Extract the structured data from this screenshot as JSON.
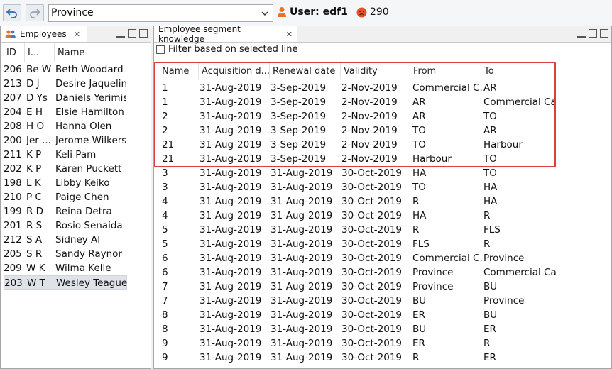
{
  "toolbar": {
    "province_value": "Province",
    "user_label": "User: edf1",
    "badge_count": "290"
  },
  "employees_panel": {
    "tab_label": "Employees",
    "col_id": "ID",
    "col_initials": "I...",
    "col_name": "Name",
    "rows": [
      {
        "id": "206",
        "ini": "Be W",
        "name": "Beth Woodard"
      },
      {
        "id": "213",
        "ini": "D J",
        "name": "Desire Jaqueline"
      },
      {
        "id": "207",
        "ini": "D Ys",
        "name": "Daniels Yerimis"
      },
      {
        "id": "204",
        "ini": "E H",
        "name": "Elsie Hamilton"
      },
      {
        "id": "208",
        "ini": "H O",
        "name": "Hanna Olen"
      },
      {
        "id": "200",
        "ini": "Jer ...",
        "name": "Jerome Wilkers..."
      },
      {
        "id": "211",
        "ini": "K P",
        "name": "Keli Pam"
      },
      {
        "id": "202",
        "ini": "K P",
        "name": "Karen Puckett"
      },
      {
        "id": "198",
        "ini": "L K",
        "name": "Libby Keiko"
      },
      {
        "id": "210",
        "ini": "P C",
        "name": "Paige Chen"
      },
      {
        "id": "199",
        "ini": "R D",
        "name": "Reina Detra"
      },
      {
        "id": "201",
        "ini": "R S",
        "name": "Rosio Senaida"
      },
      {
        "id": "212",
        "ini": "S A",
        "name": "Sidney Al"
      },
      {
        "id": "205",
        "ini": "S R",
        "name": "Sandy Raynor"
      },
      {
        "id": "209",
        "ini": "W K",
        "name": "Wilma Kelle"
      },
      {
        "id": "203",
        "ini": "W T",
        "name": "Wesley Teague"
      }
    ]
  },
  "segment_panel": {
    "tab_label": "Employee segment knowledge",
    "filter_label": "Filter based on selected line",
    "columns": [
      "Name",
      "Acquisition d...",
      "Renewal date",
      "Validity",
      "From",
      "To"
    ],
    "rows": [
      [
        "1",
        "31-Aug-2019",
        "3-Sep-2019",
        "2-Nov-2019",
        "Commercial C...",
        "AR"
      ],
      [
        "1",
        "31-Aug-2019",
        "3-Sep-2019",
        "2-Nov-2019",
        "AR",
        "Commercial Ca..."
      ],
      [
        "2",
        "31-Aug-2019",
        "3-Sep-2019",
        "2-Nov-2019",
        "AR",
        "TO"
      ],
      [
        "2",
        "31-Aug-2019",
        "3-Sep-2019",
        "2-Nov-2019",
        "TO",
        "AR"
      ],
      [
        "21",
        "31-Aug-2019",
        "3-Sep-2019",
        "2-Nov-2019",
        "TO",
        "Harbour"
      ],
      [
        "21",
        "31-Aug-2019",
        "3-Sep-2019",
        "2-Nov-2019",
        "Harbour",
        "TO"
      ],
      [
        "3",
        "31-Aug-2019",
        "31-Aug-2019",
        "30-Oct-2019",
        "HA",
        "TO"
      ],
      [
        "3",
        "31-Aug-2019",
        "31-Aug-2019",
        "30-Oct-2019",
        "TO",
        "HA"
      ],
      [
        "4",
        "31-Aug-2019",
        "31-Aug-2019",
        "30-Oct-2019",
        "R",
        "HA"
      ],
      [
        "4",
        "31-Aug-2019",
        "31-Aug-2019",
        "30-Oct-2019",
        "HA",
        "R"
      ],
      [
        "5",
        "31-Aug-2019",
        "31-Aug-2019",
        "30-Oct-2019",
        "R",
        "FLS"
      ],
      [
        "5",
        "31-Aug-2019",
        "31-Aug-2019",
        "30-Oct-2019",
        "FLS",
        "R"
      ],
      [
        "6",
        "31-Aug-2019",
        "31-Aug-2019",
        "30-Oct-2019",
        "Commercial C...",
        "Province"
      ],
      [
        "6",
        "31-Aug-2019",
        "31-Aug-2019",
        "30-Oct-2019",
        "Province",
        "Commercial Ca..."
      ],
      [
        "7",
        "31-Aug-2019",
        "31-Aug-2019",
        "30-Oct-2019",
        "Province",
        "BU"
      ],
      [
        "7",
        "31-Aug-2019",
        "31-Aug-2019",
        "30-Oct-2019",
        "BU",
        "Province"
      ],
      [
        "8",
        "31-Aug-2019",
        "31-Aug-2019",
        "30-Oct-2019",
        "ER",
        "BU"
      ],
      [
        "8",
        "31-Aug-2019",
        "31-Aug-2019",
        "30-Oct-2019",
        "BU",
        "ER"
      ],
      [
        "9",
        "31-Aug-2019",
        "31-Aug-2019",
        "30-Oct-2019",
        "ER",
        "R"
      ],
      [
        "9",
        "31-Aug-2019",
        "31-Aug-2019",
        "30-Oct-2019",
        "R",
        "ER"
      ]
    ]
  },
  "colors": {
    "highlight": "#d9413c",
    "selected_row": "#dfe3e8",
    "undo_icon": "#2b6cb0"
  }
}
